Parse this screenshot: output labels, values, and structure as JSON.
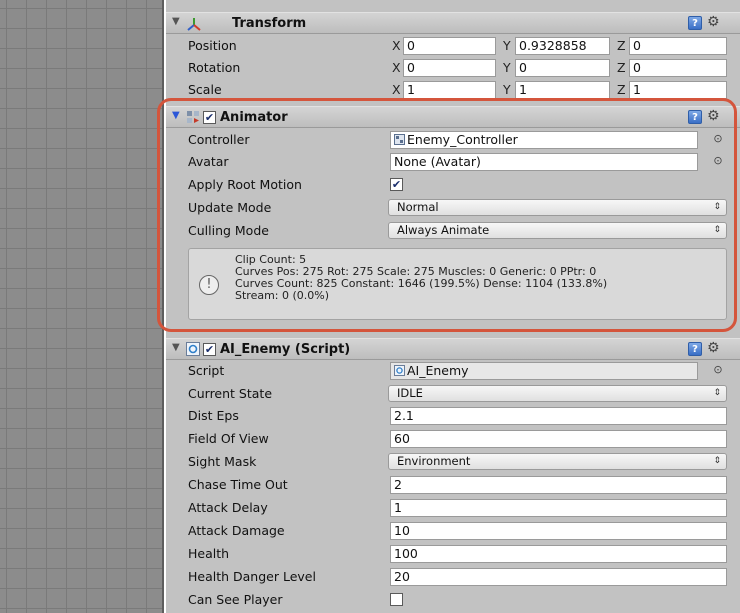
{
  "transform": {
    "title": "Transform",
    "position": {
      "label": "Position",
      "x": "0",
      "y": "0.9328858",
      "z": "0"
    },
    "rotation": {
      "label": "Rotation",
      "x": "0",
      "y": "0",
      "z": "0"
    },
    "scale": {
      "label": "Scale",
      "x": "1",
      "y": "1",
      "z": "1"
    },
    "axis": {
      "x": "X",
      "y": "Y",
      "z": "Z"
    }
  },
  "animator": {
    "title": "Animator",
    "enabled": true,
    "controller": {
      "label": "Controller",
      "value": "Enemy_Controller"
    },
    "avatar": {
      "label": "Avatar",
      "value": "None (Avatar)"
    },
    "apply_root_motion": {
      "label": "Apply Root Motion",
      "checked": "✔"
    },
    "update_mode": {
      "label": "Update Mode",
      "value": "Normal"
    },
    "culling_mode": {
      "label": "Culling Mode",
      "value": "Always Animate"
    },
    "info": {
      "line1": "Clip Count: 5",
      "line2": "Curves Pos: 275 Rot: 275 Scale: 275 Muscles: 0 Generic: 0 PPtr: 0",
      "line3": "Curves Count: 825 Constant: 1646 (199.5%) Dense: 1104 (133.8%)",
      "line4": "Stream: 0 (0.0%)"
    }
  },
  "ai_enemy": {
    "title": "AI_Enemy (Script)",
    "enabled": true,
    "script": {
      "label": "Script",
      "value": "AI_Enemy"
    },
    "current_state": {
      "label": "Current State",
      "value": "IDLE"
    },
    "dist_eps": {
      "label": "Dist Eps",
      "value": "2.1"
    },
    "field_of_view": {
      "label": "Field Of View",
      "value": "60"
    },
    "sight_mask": {
      "label": "Sight Mask",
      "value": "Environment"
    },
    "chase_time_out": {
      "label": "Chase Time Out",
      "value": "2"
    },
    "attack_delay": {
      "label": "Attack Delay",
      "value": "1"
    },
    "attack_damage": {
      "label": "Attack Damage",
      "value": "10"
    },
    "health": {
      "label": "Health",
      "value": "100"
    },
    "health_danger_level": {
      "label": "Health Danger Level",
      "value": "20"
    },
    "can_see_player": {
      "label": "Can See Player",
      "checked": ""
    }
  },
  "icons": {
    "help": "?",
    "gear": "⚙",
    "dropdown_arrow": "⇕",
    "target": "⊙",
    "info": "!",
    "fold_open": "▼",
    "fold_closed": "▼"
  },
  "colors": {
    "highlight": "#d4553c",
    "inspector_bg": "#c2c2c2",
    "foldout_open": "#2b57d8"
  }
}
